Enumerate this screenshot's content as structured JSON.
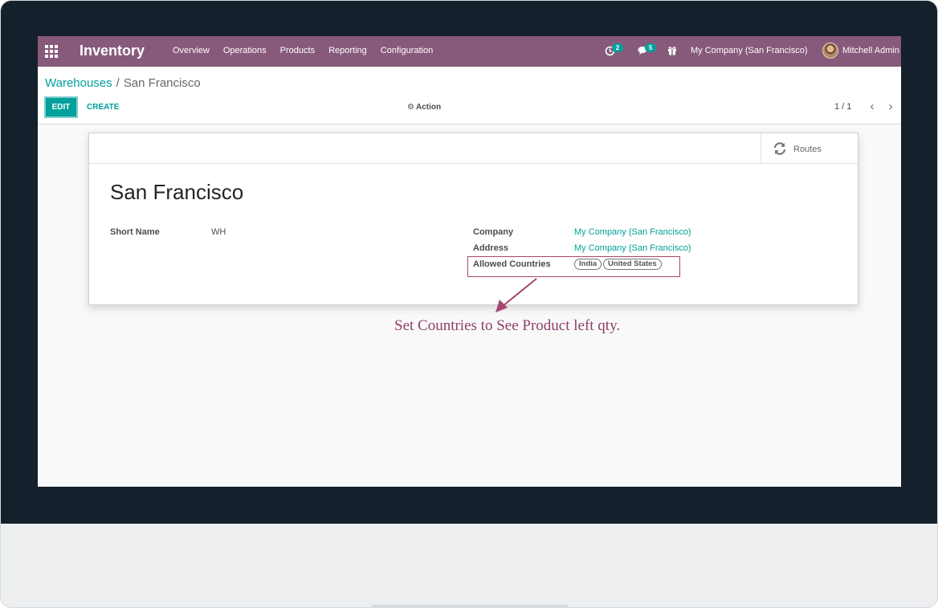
{
  "navbar": {
    "app_title": "Inventory",
    "menu": [
      "Overview",
      "Operations",
      "Products",
      "Reporting",
      "Configuration"
    ],
    "activity_badge": "2",
    "messages_badge": "5",
    "company": "My Company (San Francisco)",
    "user": "Mitchell Admin",
    "color": "#875a7b"
  },
  "breadcrumb": {
    "parent": "Warehouses",
    "current": "San Francisco"
  },
  "control_panel": {
    "edit_label": "EDIT",
    "create_label": "CREATE",
    "action_label": "Action",
    "pager": "1 / 1"
  },
  "form": {
    "routes_label": "Routes",
    "title": "San Francisco",
    "short_name_label": "Short Name",
    "short_name_value": "WH",
    "company_label": "Company",
    "company_value": "My Company (San Francisco)",
    "address_label": "Address",
    "address_value": "My Company (San Francisco)",
    "allowed_countries_label": "Allowed Countries",
    "allowed_countries": [
      "India",
      "United States"
    ]
  },
  "annotation": {
    "text": "Set Countries to See Product left qty.",
    "color": "#a6466f"
  },
  "accent_color": "#00a09d"
}
